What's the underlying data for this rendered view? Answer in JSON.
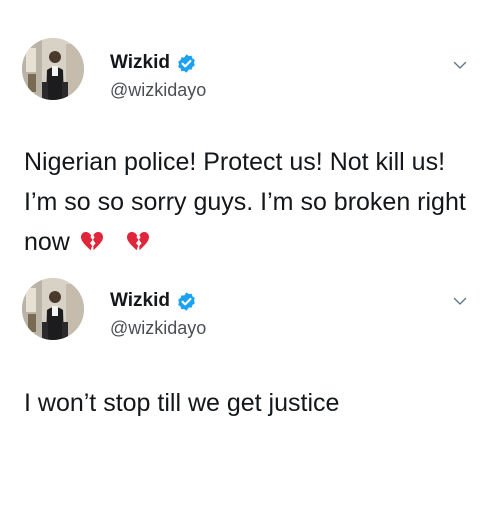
{
  "tweets": [
    {
      "display_name": "Wizkid",
      "handle": "@wizkidayo",
      "text": "Nigerian police! Protect us! Not kill us! I’m so so sorry guys. I’m so broken right now",
      "emoji": [
        "broken-heart",
        "broken-heart"
      ],
      "verified": true
    },
    {
      "display_name": "Wizkid",
      "handle": "@wizkidayo",
      "text": "I won’t stop till we get justice",
      "verified": true
    }
  ],
  "colors": {
    "text": "#14171a",
    "handle": "#4a4f55",
    "verified_badge": "#1da1f2",
    "broken_heart": "#e0263a"
  },
  "icons": {
    "verified": "verified-badge-icon",
    "chevron": "chevron-down-icon",
    "emoji": "broken-heart-icon"
  }
}
